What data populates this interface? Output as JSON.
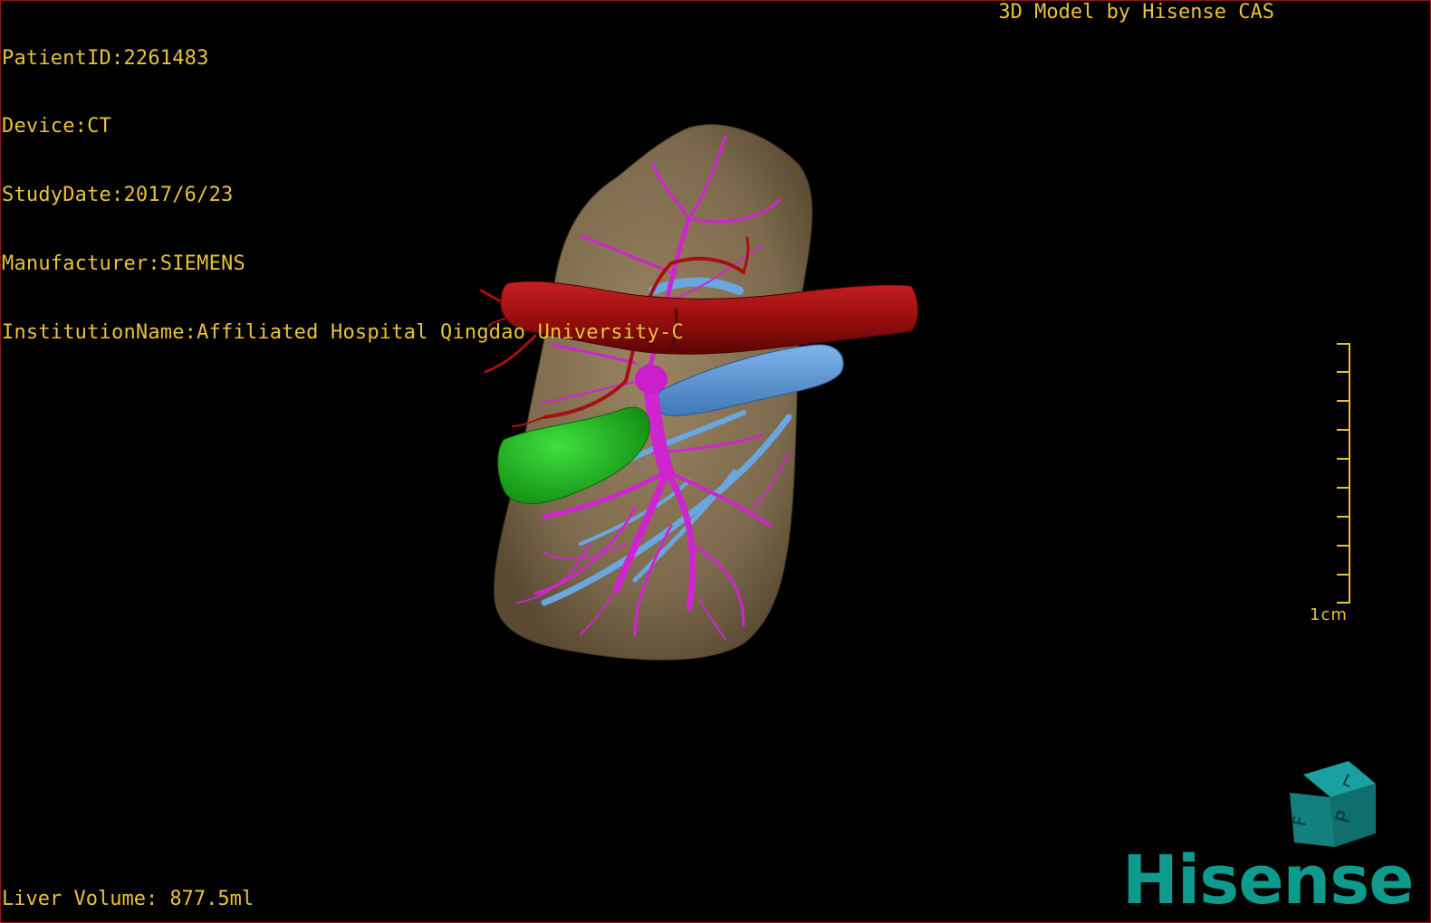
{
  "header": {
    "patient_id": "PatientID:2261483",
    "device": "Device:CT",
    "study_date": "StudyDate:2017/6/23",
    "manufacturer": "Manufacturer:SIEMENS",
    "institution": "InstitutionName:Affiliated Hospital Qingdao University-C",
    "model_credit": "3D Model by Hisense CAS"
  },
  "footer": {
    "liver_volume": "Liver Volume: 877.5ml"
  },
  "scale_bar": {
    "label": "1cm"
  },
  "orientation_cube": {
    "faces": [
      "F",
      "L",
      "P"
    ]
  },
  "brand": {
    "logo_text": "Hisense"
  },
  "colors": {
    "text": "#e8c23a",
    "liver": "#8a7556",
    "artery_aorta": "#a01010",
    "portal_vein": "#d020d0",
    "ivc": "#5e9ad8",
    "gallbladder": "#1fb820",
    "logo": "#0e9a8c",
    "cube": "#137f7f"
  },
  "icons": {
    "orientation_cube": "orientation-cube-icon",
    "scale_bar": "scale-bar-icon"
  }
}
